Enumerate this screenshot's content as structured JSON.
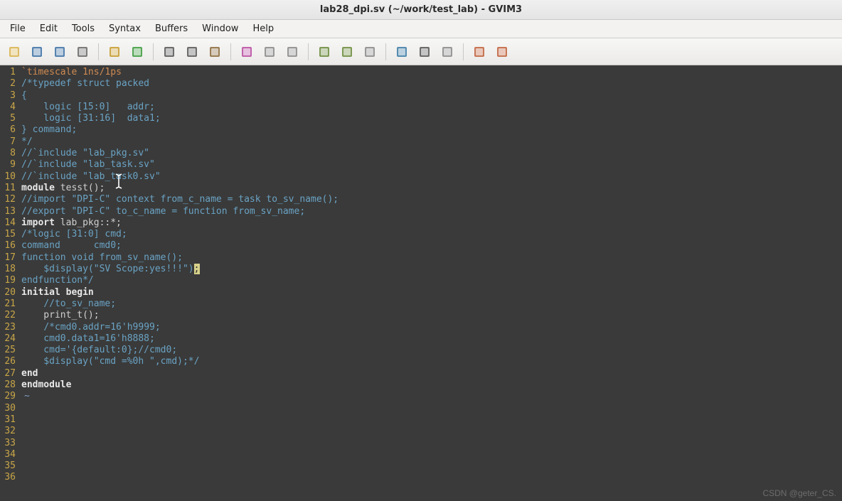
{
  "window": {
    "title": "lab28_dpi.sv (~/work/test_lab) - GVIM3"
  },
  "menus": [
    "File",
    "Edit",
    "Tools",
    "Syntax",
    "Buffers",
    "Window",
    "Help"
  ],
  "toolbar_icons": [
    "open-icon",
    "save-icon",
    "save-all-icon",
    "print-icon",
    "sep",
    "undo-icon",
    "redo-icon",
    "sep",
    "cut-icon",
    "copy-icon",
    "paste-icon",
    "sep",
    "find-replace-icon",
    "find-next-icon",
    "find-prev-icon",
    "sep",
    "load-session-icon",
    "save-session-icon",
    "run-script-icon",
    "sep",
    "make-icon",
    "shell-icon",
    "tags-icon",
    "sep",
    "help-icon",
    "find-help-icon"
  ],
  "code": [
    {
      "n": 1,
      "t": [
        {
          "c": "c-dir",
          "s": "`timescale"
        },
        {
          "s": " "
        },
        {
          "c": "c-num",
          "s": "1ns"
        },
        {
          "c": "c-dir",
          "s": "/"
        },
        {
          "c": "c-num",
          "s": "1ps"
        }
      ]
    },
    {
      "n": 2,
      "t": [
        {
          "c": "c-cmt",
          "s": "/*typedef struct packed"
        }
      ]
    },
    {
      "n": 3,
      "t": [
        {
          "c": "c-cmt",
          "s": "{"
        }
      ]
    },
    {
      "n": 4,
      "t": [
        {
          "c": "c-cmt",
          "s": "    logic [15:0]   addr;"
        }
      ]
    },
    {
      "n": 5,
      "t": [
        {
          "c": "c-cmt",
          "s": "    logic [31:16]  data1;"
        }
      ]
    },
    {
      "n": 6,
      "t": [
        {
          "c": "c-cmt",
          "s": "} command;"
        }
      ]
    },
    {
      "n": 7,
      "t": [
        {
          "c": "c-cmt",
          "s": "*/"
        }
      ]
    },
    {
      "n": 8,
      "t": [
        {
          "c": "c-cmt",
          "s": "//`include \"lab_pkg.sv\""
        }
      ]
    },
    {
      "n": 9,
      "t": [
        {
          "c": "c-cmt",
          "s": "//`include \"lab_task.sv\""
        }
      ]
    },
    {
      "n": 10,
      "t": [
        {
          "c": "c-cmt",
          "s": "//`include \"lab_task0.sv\""
        }
      ]
    },
    {
      "n": 11,
      "t": []
    },
    {
      "n": 12,
      "t": [
        {
          "c": "c-kw",
          "s": "module"
        },
        {
          "s": " tesst();"
        }
      ]
    },
    {
      "n": 13,
      "t": [
        {
          "c": "c-cmt",
          "s": "//import \"DPI-C\" context from_c_name = task to_sv_name();"
        }
      ]
    },
    {
      "n": 14,
      "t": [
        {
          "c": "c-cmt",
          "s": "//export \"DPI-C\" to_c_name = function from_sv_name;"
        }
      ]
    },
    {
      "n": 15,
      "t": []
    },
    {
      "n": 16,
      "t": [
        {
          "c": "c-kw",
          "s": "import"
        },
        {
          "s": " lab_pkg::*;"
        }
      ]
    },
    {
      "n": 17,
      "t": []
    },
    {
      "n": 18,
      "t": [
        {
          "c": "c-cmt",
          "s": "/*logic [31:0] cmd;"
        }
      ]
    },
    {
      "n": 19,
      "t": [
        {
          "c": "c-cmt",
          "s": "command      cmd0;"
        }
      ]
    },
    {
      "n": 20,
      "t": []
    },
    {
      "n": 21,
      "t": []
    },
    {
      "n": 22,
      "t": [
        {
          "c": "c-cmt",
          "s": "function void from_sv_name();"
        }
      ]
    },
    {
      "n": 23,
      "t": [
        {
          "c": "c-cmt",
          "s": "    $display(\"SV Scope:yes!!!\")"
        },
        {
          "cursor": true
        },
        {
          "c": "c-cmt",
          "s": ""
        }
      ]
    },
    {
      "n": 24,
      "t": [
        {
          "c": "c-cmt",
          "s": "endfunction*/"
        }
      ]
    },
    {
      "n": 25,
      "t": []
    },
    {
      "n": 26,
      "t": [
        {
          "c": "c-kw",
          "s": "initial"
        },
        {
          "s": " "
        },
        {
          "c": "c-kw",
          "s": "begin"
        }
      ]
    },
    {
      "n": 27,
      "t": [
        {
          "s": "    "
        },
        {
          "c": "c-cmt",
          "s": "//to_sv_name;"
        }
      ]
    },
    {
      "n": 28,
      "t": [
        {
          "s": "    print_t();"
        }
      ]
    },
    {
      "n": 29,
      "t": [
        {
          "s": "    "
        },
        {
          "c": "c-cmt",
          "s": "/*cmd0.addr=16'h9999;"
        }
      ]
    },
    {
      "n": 30,
      "t": [
        {
          "c": "c-cmt",
          "s": "    cmd0.data1=16'h8888;"
        }
      ]
    },
    {
      "n": 31,
      "t": []
    },
    {
      "n": 32,
      "t": [
        {
          "c": "c-cmt",
          "s": "    cmd='{default:0};//cmd0;"
        }
      ]
    },
    {
      "n": 33,
      "t": [
        {
          "c": "c-cmt",
          "s": "    $display(\"cmd =%0h \",cmd);*/"
        }
      ]
    },
    {
      "n": 34,
      "t": [
        {
          "c": "c-kw",
          "s": "end"
        }
      ]
    },
    {
      "n": 35,
      "t": []
    },
    {
      "n": 36,
      "t": [
        {
          "c": "c-kw",
          "s": "endmodule"
        }
      ]
    }
  ],
  "watermark": "CSDN @geter_CS."
}
